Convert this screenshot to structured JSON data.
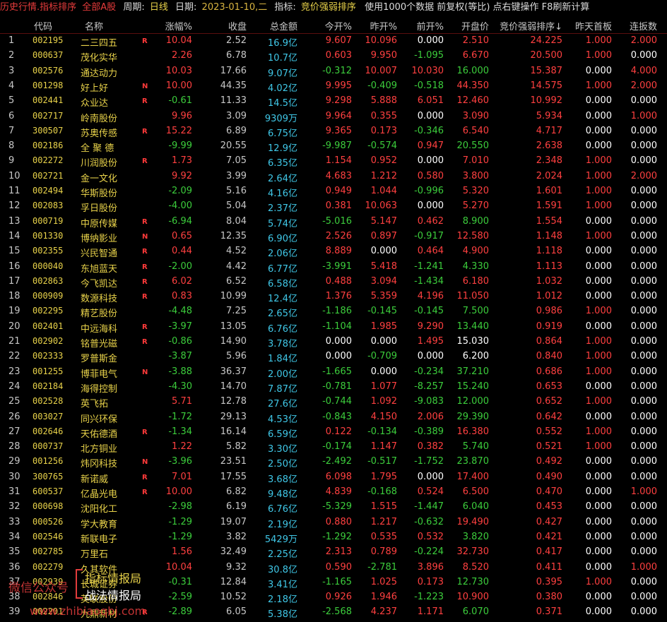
{
  "topbar": {
    "title": "历史行情.指标排序",
    "scope": "全部A股",
    "period_label": "周期:",
    "period_value": "日线",
    "date_label": "日期:",
    "date_value": "2023-01-10,二",
    "indicator_label": "指标:",
    "indicator_value": "竞价强弱排序",
    "tail": "使用1000个数据 前复权(等比) 点右键操作 F8刷新计算"
  },
  "columns": {
    "code": "代码",
    "name": "名称",
    "chg": "涨幅%",
    "close": "收盘",
    "amount": "总金额",
    "today_open": "今开%",
    "yest_open": "昨开%",
    "prev_open": "前开%",
    "open_price": "开盘价",
    "rank": "竞价强弱排序↓",
    "yest_first": "昨天首板",
    "consec": "连扳数"
  },
  "rows": [
    {
      "i": "1",
      "code": "002195",
      "name": "二三四五",
      "flag": "R",
      "chg": "10.04",
      "close": "2.52",
      "amt": "16.9",
      "unit": "亿",
      "to": "9.607",
      "yo": "10.096",
      "po": "0.000",
      "op": "2.510",
      "rank": "24.225",
      "yf": "1.000",
      "cb": "2.000"
    },
    {
      "i": "2",
      "code": "000637",
      "name": "茂化实华",
      "flag": "",
      "chg": "2.26",
      "close": "6.78",
      "amt": "10.7",
      "unit": "亿",
      "to": "0.603",
      "yo": "9.950",
      "po": "-1.095",
      "op": "6.670",
      "rank": "20.500",
      "yf": "1.000",
      "cb": "0.000"
    },
    {
      "i": "3",
      "code": "002576",
      "name": "通达动力",
      "flag": "",
      "chg": "10.03",
      "close": "17.66",
      "amt": "9.07",
      "unit": "亿",
      "to": "-0.312",
      "yo": "10.007",
      "po": "10.030",
      "op": "16.000",
      "rank": "15.387",
      "yf": "0.000",
      "cb": "4.000"
    },
    {
      "i": "4",
      "code": "001298",
      "name": "好上好",
      "flag": "N",
      "chg": "10.00",
      "close": "44.35",
      "amt": "4.02",
      "unit": "亿",
      "to": "9.995",
      "yo": "-0.409",
      "po": "-0.518",
      "op": "44.350",
      "rank": "14.575",
      "yf": "1.000",
      "cb": "2.000"
    },
    {
      "i": "5",
      "code": "002441",
      "name": "众业达",
      "flag": "R",
      "chg": "-0.61",
      "close": "11.33",
      "amt": "14.5",
      "unit": "亿",
      "to": "9.298",
      "yo": "5.888",
      "po": "6.051",
      "op": "12.460",
      "rank": "10.992",
      "yf": "0.000",
      "cb": "0.000"
    },
    {
      "i": "6",
      "code": "002717",
      "name": "岭南股份",
      "flag": "",
      "chg": "9.96",
      "close": "3.09",
      "amt": "9309",
      "unit": "万",
      "to": "9.964",
      "yo": "0.355",
      "po": "0.000",
      "op": "3.090",
      "rank": "5.934",
      "yf": "0.000",
      "cb": "1.000"
    },
    {
      "i": "7",
      "code": "300507",
      "name": "苏奥传感",
      "flag": "R",
      "chg": "15.22",
      "close": "6.89",
      "amt": "6.75",
      "unit": "亿",
      "to": "9.365",
      "yo": "0.173",
      "po": "-0.346",
      "op": "6.540",
      "rank": "4.717",
      "yf": "0.000",
      "cb": "0.000"
    },
    {
      "i": "8",
      "code": "002186",
      "name": "全 聚 德",
      "flag": "",
      "chg": "-9.99",
      "close": "20.55",
      "amt": "12.9",
      "unit": "亿",
      "to": "-9.987",
      "yo": "-0.574",
      "po": "0.947",
      "op": "20.550",
      "rank": "2.638",
      "yf": "0.000",
      "cb": "0.000"
    },
    {
      "i": "9",
      "code": "002272",
      "name": "川润股份",
      "flag": "R",
      "chg": "1.73",
      "close": "7.05",
      "amt": "6.35",
      "unit": "亿",
      "to": "1.154",
      "yo": "0.952",
      "po": "0.000",
      "op": "7.010",
      "rank": "2.348",
      "yf": "1.000",
      "cb": "0.000"
    },
    {
      "i": "10",
      "code": "002721",
      "name": "金一文化",
      "flag": "",
      "chg": "9.92",
      "close": "3.99",
      "amt": "2.64",
      "unit": "亿",
      "to": "4.683",
      "yo": "1.212",
      "po": "0.580",
      "op": "3.800",
      "rank": "2.024",
      "yf": "1.000",
      "cb": "2.000"
    },
    {
      "i": "11",
      "code": "002494",
      "name": "华斯股份",
      "flag": "",
      "chg": "-2.09",
      "close": "5.16",
      "amt": "4.16",
      "unit": "亿",
      "to": "0.949",
      "yo": "1.044",
      "po": "-0.996",
      "op": "5.320",
      "rank": "1.601",
      "yf": "1.000",
      "cb": "0.000"
    },
    {
      "i": "12",
      "code": "002083",
      "name": "孚日股份",
      "flag": "",
      "chg": "-4.00",
      "close": "5.04",
      "amt": "2.37",
      "unit": "亿",
      "to": "0.381",
      "yo": "10.063",
      "po": "0.000",
      "op": "5.270",
      "rank": "1.591",
      "yf": "1.000",
      "cb": "0.000"
    },
    {
      "i": "13",
      "code": "000719",
      "name": "中原传媒",
      "flag": "R",
      "chg": "-6.94",
      "close": "8.04",
      "amt": "5.74",
      "unit": "亿",
      "to": "-5.016",
      "yo": "5.147",
      "po": "0.462",
      "op": "8.900",
      "rank": "1.554",
      "yf": "0.000",
      "cb": "0.000"
    },
    {
      "i": "14",
      "code": "001330",
      "name": "博纳影业",
      "flag": "N",
      "chg": "0.65",
      "close": "12.35",
      "amt": "6.90",
      "unit": "亿",
      "to": "2.526",
      "yo": "0.897",
      "po": "-0.917",
      "op": "12.580",
      "rank": "1.148",
      "yf": "1.000",
      "cb": "0.000"
    },
    {
      "i": "15",
      "code": "002355",
      "name": "兴民智通",
      "flag": "R",
      "chg": "0.44",
      "close": "4.52",
      "amt": "2.06",
      "unit": "亿",
      "to": "8.889",
      "yo": "0.000",
      "po": "0.464",
      "op": "4.900",
      "rank": "1.118",
      "yf": "0.000",
      "cb": "0.000"
    },
    {
      "i": "16",
      "code": "000040",
      "name": "东旭蓝天",
      "flag": "R",
      "chg": "-2.00",
      "close": "4.42",
      "amt": "6.77",
      "unit": "亿",
      "to": "-3.991",
      "yo": "5.418",
      "po": "-1.241",
      "op": "4.330",
      "rank": "1.113",
      "yf": "0.000",
      "cb": "0.000"
    },
    {
      "i": "17",
      "code": "002863",
      "name": "今飞凯达",
      "flag": "R",
      "chg": "6.02",
      "close": "6.52",
      "amt": "6.58",
      "unit": "亿",
      "to": "0.488",
      "yo": "3.094",
      "po": "-1.434",
      "op": "6.180",
      "rank": "1.032",
      "yf": "0.000",
      "cb": "0.000"
    },
    {
      "i": "18",
      "code": "000909",
      "name": "数源科技",
      "flag": "R",
      "chg": "0.83",
      "close": "10.99",
      "amt": "12.4",
      "unit": "亿",
      "to": "1.376",
      "yo": "5.359",
      "po": "4.196",
      "op": "11.050",
      "rank": "1.012",
      "yf": "0.000",
      "cb": "0.000"
    },
    {
      "i": "19",
      "code": "002295",
      "name": "精艺股份",
      "flag": "",
      "chg": "-4.48",
      "close": "7.25",
      "amt": "2.65",
      "unit": "亿",
      "to": "-1.186",
      "yo": "-0.145",
      "po": "-0.145",
      "op": "7.500",
      "rank": "0.986",
      "yf": "1.000",
      "cb": "0.000"
    },
    {
      "i": "20",
      "code": "002401",
      "name": "中远海科",
      "flag": "R",
      "chg": "-3.97",
      "close": "13.05",
      "amt": "6.76",
      "unit": "亿",
      "to": "-1.104",
      "yo": "1.985",
      "po": "9.290",
      "op": "13.440",
      "rank": "0.919",
      "yf": "0.000",
      "cb": "0.000"
    },
    {
      "i": "21",
      "code": "002902",
      "name": "铭普光磁",
      "flag": "R",
      "chg": "-0.86",
      "close": "14.90",
      "amt": "3.78",
      "unit": "亿",
      "to": "0.000",
      "yo": "0.000",
      "po": "1.495",
      "op": "15.030",
      "rank": "0.864",
      "yf": "1.000",
      "cb": "0.000"
    },
    {
      "i": "22",
      "code": "002333",
      "name": "罗普斯金",
      "flag": "",
      "chg": "-3.87",
      "close": "5.96",
      "amt": "1.84",
      "unit": "亿",
      "to": "0.000",
      "yo": "-0.709",
      "po": "0.000",
      "op": "6.200",
      "rank": "0.840",
      "yf": "1.000",
      "cb": "0.000"
    },
    {
      "i": "23",
      "code": "001255",
      "name": "博菲电气",
      "flag": "N",
      "chg": "-3.88",
      "close": "36.37",
      "amt": "2.00",
      "unit": "亿",
      "to": "-1.665",
      "yo": "0.000",
      "po": "-0.234",
      "op": "37.210",
      "rank": "0.686",
      "yf": "1.000",
      "cb": "0.000"
    },
    {
      "i": "24",
      "code": "002184",
      "name": "海得控制",
      "flag": "",
      "chg": "-4.30",
      "close": "14.70",
      "amt": "7.87",
      "unit": "亿",
      "to": "-0.781",
      "yo": "1.077",
      "po": "-8.257",
      "op": "15.240",
      "rank": "0.653",
      "yf": "0.000",
      "cb": "0.000"
    },
    {
      "i": "25",
      "code": "002528",
      "name": "英飞拓",
      "flag": "",
      "chg": "5.71",
      "close": "12.78",
      "amt": "27.6",
      "unit": "亿",
      "to": "-0.744",
      "yo": "1.092",
      "po": "-9.083",
      "op": "12.000",
      "rank": "0.652",
      "yf": "1.000",
      "cb": "0.000"
    },
    {
      "i": "26",
      "code": "003027",
      "name": "同兴环保",
      "flag": "",
      "chg": "-1.72",
      "close": "29.13",
      "amt": "4.53",
      "unit": "亿",
      "to": "-0.843",
      "yo": "4.150",
      "po": "2.006",
      "op": "29.390",
      "rank": "0.642",
      "yf": "0.000",
      "cb": "0.000"
    },
    {
      "i": "27",
      "code": "002646",
      "name": "天佑德酒",
      "flag": "R",
      "chg": "-1.34",
      "close": "16.14",
      "amt": "6.59",
      "unit": "亿",
      "to": "0.122",
      "yo": "-0.134",
      "po": "-0.389",
      "op": "16.380",
      "rank": "0.552",
      "yf": "1.000",
      "cb": "0.000"
    },
    {
      "i": "28",
      "code": "000737",
      "name": "北方铜业",
      "flag": "",
      "chg": "1.22",
      "close": "5.82",
      "amt": "3.30",
      "unit": "亿",
      "to": "-0.174",
      "yo": "1.147",
      "po": "0.382",
      "op": "5.740",
      "rank": "0.521",
      "yf": "1.000",
      "cb": "0.000"
    },
    {
      "i": "29",
      "code": "001256",
      "name": "炜冈科技",
      "flag": "N",
      "chg": "-3.96",
      "close": "23.51",
      "amt": "2.50",
      "unit": "亿",
      "to": "-2.492",
      "yo": "-0.517",
      "po": "-1.752",
      "op": "23.870",
      "rank": "0.492",
      "yf": "0.000",
      "cb": "0.000"
    },
    {
      "i": "30",
      "code": "300765",
      "name": "新诺威",
      "flag": "R",
      "chg": "7.01",
      "close": "17.55",
      "amt": "3.68",
      "unit": "亿",
      "to": "6.098",
      "yo": "1.795",
      "po": "0.000",
      "op": "17.400",
      "rank": "0.490",
      "yf": "0.000",
      "cb": "0.000"
    },
    {
      "i": "31",
      "code": "600537",
      "name": "亿晶光电",
      "flag": "R",
      "chg": "10.00",
      "close": "6.82",
      "amt": "9.48",
      "unit": "亿",
      "to": "4.839",
      "yo": "-0.168",
      "po": "0.524",
      "op": "6.500",
      "rank": "0.470",
      "yf": "0.000",
      "cb": "1.000"
    },
    {
      "i": "32",
      "code": "000698",
      "name": "沈阳化工",
      "flag": "",
      "chg": "-2.98",
      "close": "6.19",
      "amt": "6.76",
      "unit": "亿",
      "to": "-5.329",
      "yo": "1.515",
      "po": "-1.447",
      "op": "6.040",
      "rank": "0.453",
      "yf": "0.000",
      "cb": "0.000"
    },
    {
      "i": "33",
      "code": "000526",
      "name": "学大教育",
      "flag": "",
      "chg": "-1.29",
      "close": "19.07",
      "amt": "2.19",
      "unit": "亿",
      "to": "0.880",
      "yo": "1.217",
      "po": "-0.632",
      "op": "19.490",
      "rank": "0.427",
      "yf": "0.000",
      "cb": "0.000"
    },
    {
      "i": "34",
      "code": "002546",
      "name": "新联电子",
      "flag": "",
      "chg": "-1.29",
      "close": "3.82",
      "amt": "5429",
      "unit": "万",
      "to": "-1.292",
      "yo": "0.535",
      "po": "0.532",
      "op": "3.820",
      "rank": "0.421",
      "yf": "0.000",
      "cb": "0.000"
    },
    {
      "i": "35",
      "code": "002785",
      "name": "万里石",
      "flag": "",
      "chg": "1.56",
      "close": "32.49",
      "amt": "2.25",
      "unit": "亿",
      "to": "2.313",
      "yo": "0.789",
      "po": "-0.224",
      "op": "32.730",
      "rank": "0.417",
      "yf": "0.000",
      "cb": "0.000"
    },
    {
      "i": "36",
      "code": "002279",
      "name": "久其软件",
      "flag": "",
      "chg": "10.04",
      "close": "9.32",
      "amt": "30.8",
      "unit": "亿",
      "to": "0.590",
      "yo": "-2.781",
      "po": "3.896",
      "op": "8.520",
      "rank": "0.411",
      "yf": "0.000",
      "cb": "1.000"
    },
    {
      "i": "37",
      "code": "002939",
      "name": "长城证券",
      "flag": "",
      "chg": "-0.31",
      "close": "12.84",
      "amt": "3.41",
      "unit": "亿",
      "to": "-1.165",
      "yo": "1.025",
      "po": "0.173",
      "op": "12.730",
      "rank": "0.395",
      "yf": "1.000",
      "cb": "0.000"
    },
    {
      "i": "38",
      "code": "002846",
      "name": "英联股份",
      "flag": "",
      "chg": "-2.59",
      "close": "10.52",
      "amt": "2.18",
      "unit": "亿",
      "to": "0.926",
      "yo": "1.946",
      "po": "-1.223",
      "op": "10.900",
      "rank": "0.380",
      "yf": "0.000",
      "cb": "0.000"
    },
    {
      "i": "39",
      "code": "002201",
      "name": "九鼎新材",
      "flag": "R",
      "chg": "-2.89",
      "close": "6.05",
      "amt": "5.38",
      "unit": "亿",
      "to": "-2.568",
      "yo": "4.237",
      "po": "1.171",
      "op": "6.070",
      "rank": "0.371",
      "yf": "0.000",
      "cb": "0.000"
    }
  ],
  "watermark": {
    "wechat": "微信公众号",
    "line1": "指标情报局",
    "line2": "战法情报局",
    "site": "www.zhibiaoqbj.com"
  }
}
